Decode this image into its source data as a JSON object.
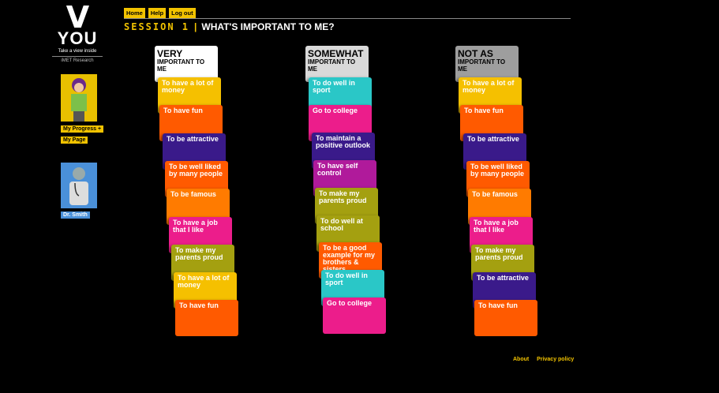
{
  "logo": {
    "letter": "V",
    "word": "YOU",
    "tagline": "Take a view inside",
    "org": "iMET Research"
  },
  "sidebar": {
    "progress": "My Progress",
    "progress_icon": "+",
    "page": "My Page",
    "doctor": "Dr. Smith"
  },
  "nav": [
    "Home",
    "Help",
    "Log out"
  ],
  "header": {
    "session": "SESSION 1",
    "title": "WHAT'S IMPORTANT TO ME?"
  },
  "columns": [
    {
      "big": "VERY",
      "small": "IMPORTANT TO ME",
      "head_color": "#ffffff",
      "cards": [
        {
          "text": "To have a lot of money",
          "color": "#f5c000"
        },
        {
          "text": "To have fun",
          "color": "#ff5a00"
        },
        {
          "text": "To be attractive",
          "color": "#3a1a8a"
        },
        {
          "text": "To be well liked by many people",
          "color": "#ff5a00"
        },
        {
          "text": "To be famous",
          "color": "#ff7b00"
        },
        {
          "text": "To have a job that I like",
          "color": "#ec1d8b"
        },
        {
          "text": "To make my parents proud",
          "color": "#a4a010"
        },
        {
          "text": "To have a lot of money",
          "color": "#f5c000"
        },
        {
          "text": "To have fun",
          "color": "#ff5a00"
        }
      ]
    },
    {
      "big": "SOMEWHAT",
      "small": "IMPORTANT TO ME",
      "head_color": "#d9d9d9",
      "cards": [
        {
          "text": "To do well in sport",
          "color": "#2ac7c7"
        },
        {
          "text": "Go to college",
          "color": "#ec1d8b"
        },
        {
          "text": "To maintain a positive outlook",
          "color": "#3a1a8a"
        },
        {
          "text": "To have self control",
          "color": "#b01a9b"
        },
        {
          "text": "To make my parents proud",
          "color": "#a4a010"
        },
        {
          "text": "To do well at school",
          "color": "#a4a010"
        },
        {
          "text": "To be a good example for my brothers & sisters",
          "color": "#ff5a00"
        },
        {
          "text": "To do well in sport",
          "color": "#2ac7c7"
        },
        {
          "text": "Go to college",
          "color": "#ec1d8b"
        }
      ]
    },
    {
      "big": "NOT AS",
      "small": "IMPORTANT TO ME",
      "head_color": "#9e9e9e",
      "cards": [
        {
          "text": "To have a lot of money",
          "color": "#f5c000"
        },
        {
          "text": "To have fun",
          "color": "#ff5a00"
        },
        {
          "text": "To be attractive",
          "color": "#3a1a8a"
        },
        {
          "text": "To be well liked by many people",
          "color": "#ff5a00"
        },
        {
          "text": "To be famous",
          "color": "#ff7b00"
        },
        {
          "text": "To have a job that I like",
          "color": "#ec1d8b"
        },
        {
          "text": "To make my parents proud",
          "color": "#a4a010"
        },
        {
          "text": "To be attractive",
          "color": "#3a1a8a"
        },
        {
          "text": "To have fun",
          "color": "#ff5a00"
        }
      ]
    }
  ],
  "footer": {
    "about": "About",
    "privacy": "Privacy policy"
  }
}
